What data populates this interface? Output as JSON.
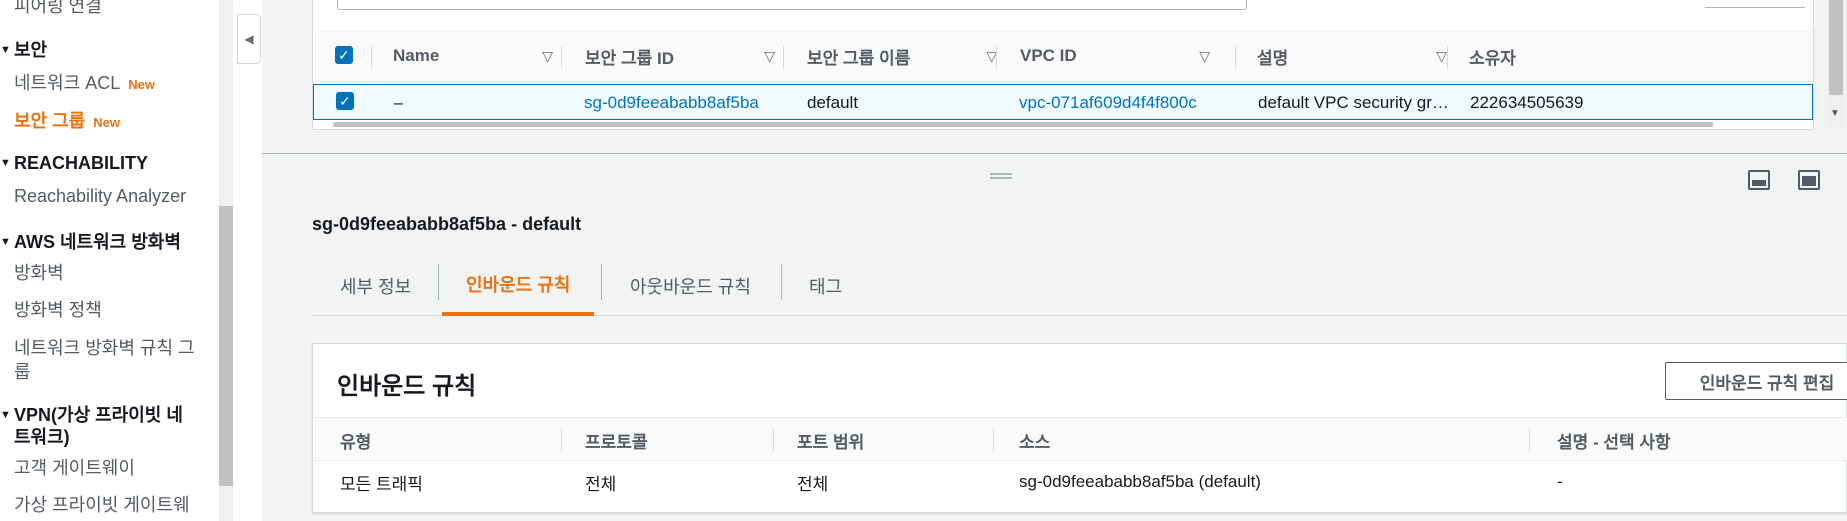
{
  "sidebar": {
    "items": [
      {
        "label": "피어링 연결"
      },
      {
        "section": "보안"
      },
      {
        "label": "네트워크 ACL",
        "badge": "New"
      },
      {
        "label": "보안 그룹",
        "badge": "New",
        "active": true
      },
      {
        "section": "REACHABILITY"
      },
      {
        "label": "Reachability Analyzer"
      },
      {
        "section": "AWS 네트워크 방화벽"
      },
      {
        "label": "방화벽"
      },
      {
        "label": "방화벽 정책"
      },
      {
        "label": "네트워크 방화벽 규칙 그"
      },
      {
        "label": "룹"
      },
      {
        "section": "VPN(가상 프라이빗 네"
      },
      {
        "section": "트워크)"
      },
      {
        "label": "고객 게이트웨이"
      },
      {
        "label": "가상 프라이빗 게이트웨"
      }
    ]
  },
  "table": {
    "columns": [
      "Name",
      "보안 그룹 ID",
      "보안 그룹 이름",
      "VPC ID",
      "설명",
      "소유자"
    ],
    "row": {
      "name": "–",
      "group_id": "sg-0d9feeababb8af5ba",
      "group_name": "default",
      "vpc_id": "vpc-071af609d4f4f800c",
      "description": "default VPC security gr…",
      "owner": "222634505639"
    }
  },
  "detail": {
    "title": "sg-0d9feeababb8af5ba - default",
    "tabs": [
      "세부 정보",
      "인바운드 규칙",
      "아웃바운드 규칙",
      "태그"
    ],
    "active_tab": "인바운드 규칙"
  },
  "inbound": {
    "title": "인바운드 규칙",
    "edit_button": "인바운드 규칙 편집",
    "columns": [
      "유형",
      "프로토콜",
      "포트 범위",
      "소스",
      "설명 - 선택 사항"
    ],
    "rows": [
      {
        "type": "모든 트래픽",
        "protocol": "전체",
        "port_range": "전체",
        "source": "sg-0d9feeababb8af5ba (default)",
        "description": "-"
      }
    ]
  },
  "colors": {
    "accent": "#ec7211",
    "link": "#0073bb"
  }
}
